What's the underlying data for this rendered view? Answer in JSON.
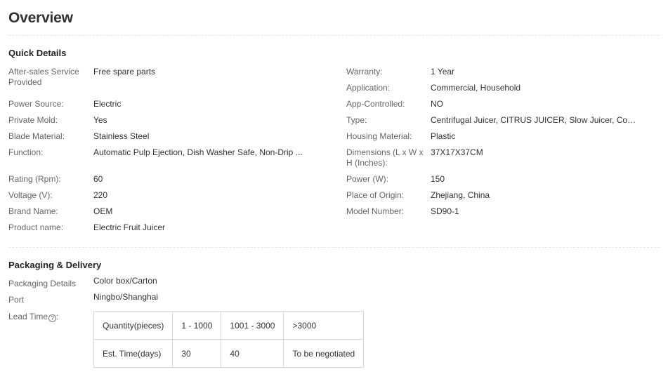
{
  "overview": {
    "title": "Overview"
  },
  "quick_details": {
    "title": "Quick Details",
    "left": [
      {
        "label": "After-sales Service Provided",
        "value": "Free spare parts"
      },
      {
        "label": "Power Source:",
        "value": "Electric"
      },
      {
        "label": "Private Mold:",
        "value": "Yes"
      },
      {
        "label": "Blade Material:",
        "value": "Stainless Steel"
      },
      {
        "label": "Function:",
        "value": "Automatic Pulp Ejection, Dish Washer Safe, Non-Drip ..."
      },
      {
        "label": "Rating (Rpm):",
        "value": "60"
      },
      {
        "label": "Voltage (V):",
        "value": "220"
      },
      {
        "label": "Brand Name:",
        "value": "OEM"
      },
      {
        "label": "Product name:",
        "value": "Electric Fruit Juicer"
      }
    ],
    "right": [
      {
        "label": "Warranty:",
        "value": "1 Year"
      },
      {
        "label": "Application:",
        "value": "Commercial, Household"
      },
      {
        "label": "App-Controlled:",
        "value": "NO"
      },
      {
        "label": "Type:",
        "value": "Centrifugal Juicer, CITRUS JUICER, Slow Juicer, Com..."
      },
      {
        "label": "Housing Material:",
        "value": "Plastic"
      },
      {
        "label": "Dimensions (L x W x H (Inches):",
        "value": "37X17X37CM"
      },
      {
        "label": "Power (W):",
        "value": "150"
      },
      {
        "label": "Place of Origin:",
        "value": "Zhejiang, China"
      },
      {
        "label": "Model Number:",
        "value": "SD90-1"
      }
    ]
  },
  "packaging": {
    "title": "Packaging & Delivery",
    "details_label": "Packaging Details",
    "details_value": "Color box/Carton",
    "port_label": "Port",
    "port_value": "Ningbo/Shanghai",
    "lead_time_label": "Lead Time",
    "lead_time_suffix": ":",
    "help_glyph": "?",
    "help_icon": "question-circle-icon",
    "lead_table": {
      "row1": [
        "Quantity(pieces)",
        "1 - 1000",
        "1001 - 3000",
        ">3000"
      ],
      "row2": [
        "Est. Time(days)",
        "30",
        "40",
        "To be negotiated"
      ]
    }
  }
}
